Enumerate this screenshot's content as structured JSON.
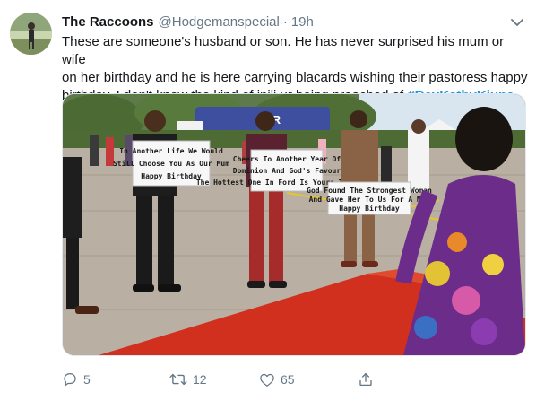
{
  "tweet": {
    "display_name": "The Raccoons",
    "handle": "@Hodgemanspecial",
    "separator": "·",
    "time": "19h",
    "text_line1": "These are someone's husband or son. He has never surprised his mum or wife",
    "text_line2": "on her birthday and he is here carrying blacards wishing their pastoress happy",
    "text_line3": "birthday. I don't know the kind of injli ur being preached of ",
    "hashtag": "#RevKathyKiuna"
  },
  "media": {
    "van_text": "CHR",
    "sign1": [
      "In Another Life We Would",
      "Still Choose You As Our Mum",
      "Happy Birthday"
    ],
    "sign2": [
      "Cheers To Another Year Of",
      "Dominion And God's Favour",
      "The Hottest One In Ford Is Yours Truly Too"
    ],
    "sign3": [
      "God Found The Strongest Woman",
      "And Gave Her To Us For A Mum",
      "Happy Birthday"
    ]
  },
  "actions": {
    "reply_count": "5",
    "retweet_count": "12",
    "like_count": "65"
  },
  "icons": {
    "reply": "reply-icon",
    "retweet": "retweet-icon",
    "like": "like-icon",
    "share": "share-icon",
    "caret": "chevron-down-icon"
  },
  "colors": {
    "accent": "#1b95e0",
    "muted": "#657786",
    "text": "#14171a"
  }
}
